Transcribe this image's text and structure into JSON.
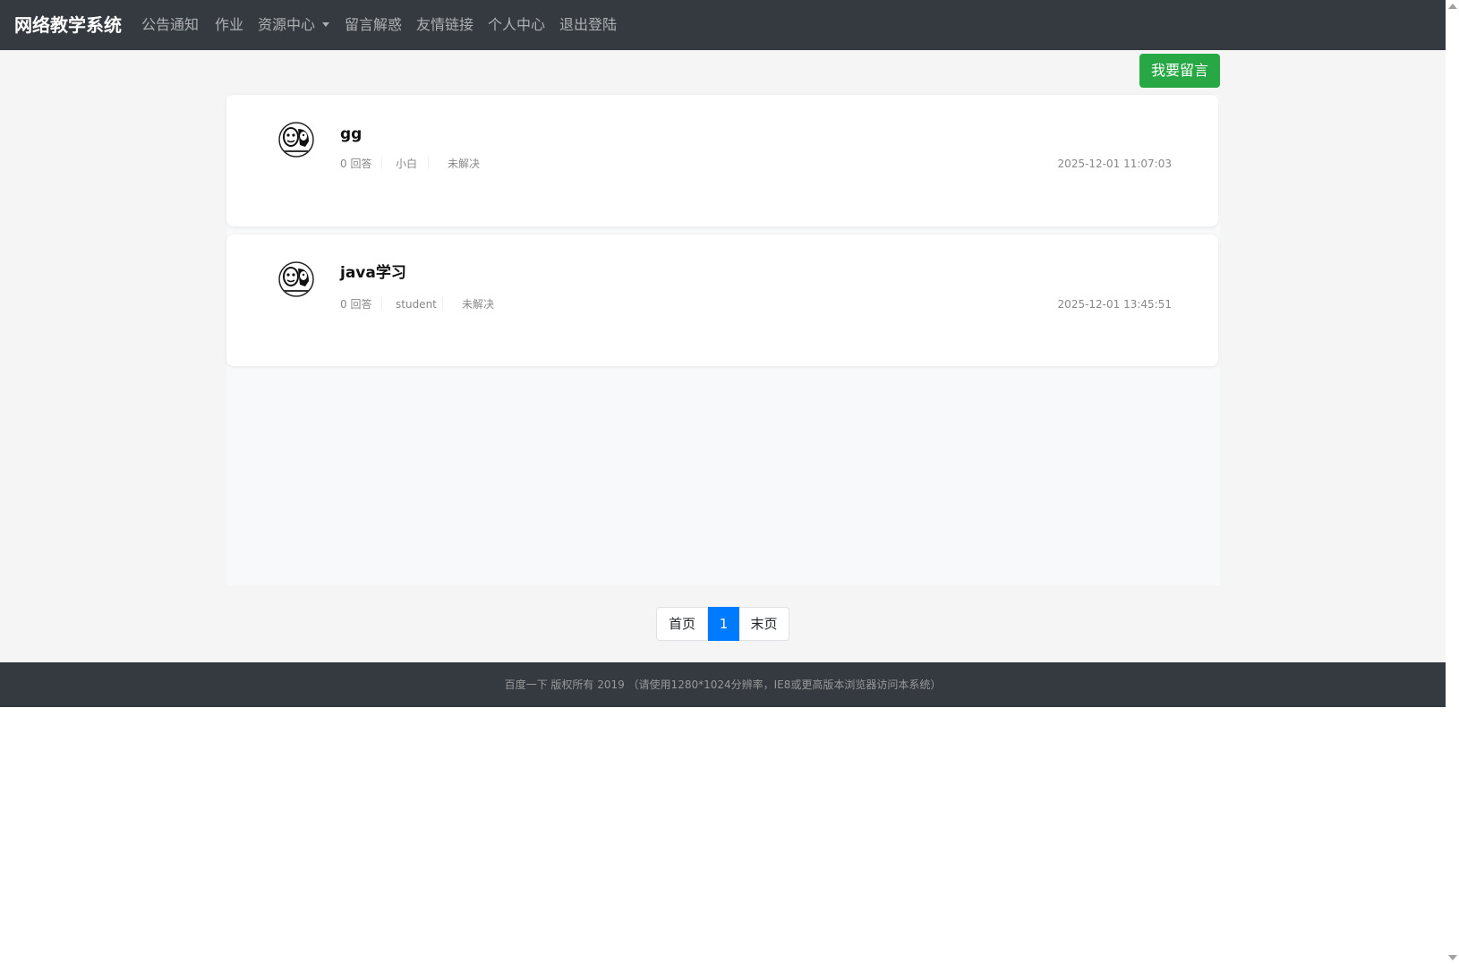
{
  "navbar": {
    "brand": "网络教学系统",
    "items": [
      {
        "label": "公告通知"
      },
      {
        "label": "作业"
      },
      {
        "label": "资源中心",
        "dropdown": true
      },
      {
        "label": "留言解惑"
      },
      {
        "label": "友情链接"
      },
      {
        "label": "个人中心"
      },
      {
        "label": "退出登陆"
      }
    ]
  },
  "main": {
    "post_button": "我要留言",
    "questions": [
      {
        "title": "gg",
        "answers": "0 回答",
        "author": "小白",
        "status": "未解决",
        "date": "2025-12-01 11:07:03",
        "avatar_icon": "meme-face-avatar-icon"
      },
      {
        "title": "java学习",
        "answers": "0 回答",
        "author": "student",
        "status": "未解决",
        "date": "2025-12-01 13:45:51",
        "avatar_icon": "meme-face-avatar-icon"
      }
    ]
  },
  "pagination": {
    "first": "首页",
    "current": "1",
    "last": "末页"
  },
  "footer": {
    "text": "百度一下  版权所有 2019   （请使用1280*1024分辨率，IE8或更高版本浏览器访问本系统）"
  },
  "colors": {
    "navbar_bg": "#343a40",
    "post_button_bg": "#28a745",
    "pagination_active": "#007bff"
  }
}
